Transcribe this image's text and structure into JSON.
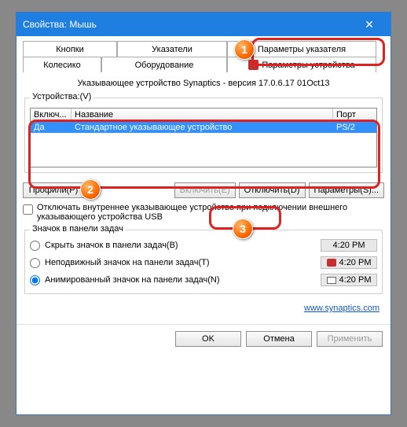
{
  "title": "Свойства: Мышь",
  "tabs_row1": {
    "t1": "Кнопки",
    "t2": "Указатели",
    "t3": "Параметры указателя"
  },
  "tabs_row2": {
    "t1": "Колесико",
    "t2": "Оборудование",
    "t3": "Параметры устройства"
  },
  "driver_info": "Указывающее устройство Synaptics - версия 17.0.6.17 01Oct13",
  "devices": {
    "label": "Устройства:(V)",
    "headers": {
      "h1": "Включ...",
      "h2": "Название",
      "h3": "Порт"
    },
    "row": {
      "c1": "Да",
      "c2": "Стандартное указывающее устройство",
      "c3": "PS/2"
    }
  },
  "buttons": {
    "profiles": "Профили(P)",
    "enable": "Включить(E)",
    "disable": "Отключить(D)",
    "params": "Параметры(S)..."
  },
  "checkbox_label": "Отключать внутреннее указывающее устройство при подключении внешнего указывающего устройства USB",
  "tray": {
    "title": "Значок в панели задач",
    "r1": "Скрыть значок в панели задач(B)",
    "r2": "Неподвижный значок на панели задач(T)",
    "r3": "Анимированный значок на панели задач(N)",
    "time1": "4:20 PM",
    "time2": "4:20 PM",
    "time3": "4:20 PM"
  },
  "link": "www.synaptics.com",
  "footer": {
    "ok": "OK",
    "cancel": "Отмена",
    "apply": "Применить"
  },
  "badges": {
    "b1": "1",
    "b2": "2",
    "b3": "3"
  }
}
